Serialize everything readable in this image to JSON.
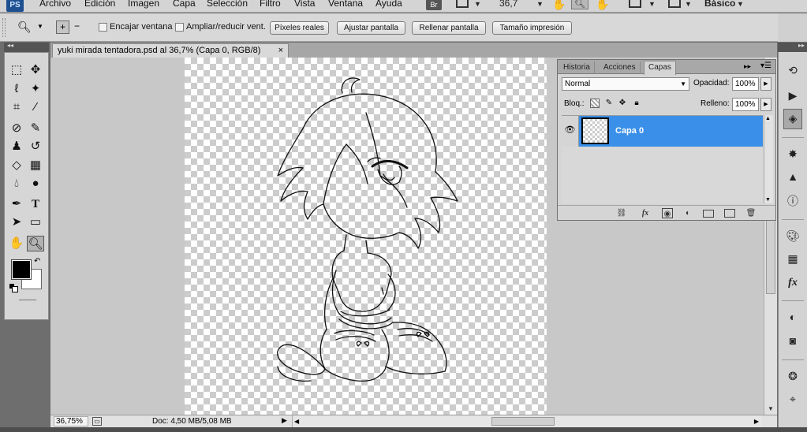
{
  "menubar": {
    "logo": "PS",
    "items": [
      "Archivo",
      "Edición",
      "Imagen",
      "Capa",
      "Selección",
      "Filtro",
      "Vista",
      "Ventana",
      "Ayuda"
    ],
    "bridge_label": "Br",
    "zoom_value": "36,7",
    "workspace": "Básico"
  },
  "options_bar": {
    "encajar_label": "Encajar ventana",
    "ampliar_label": "Ampliar/reducir vent.",
    "buttons": [
      "Píxeles reales",
      "Ajustar pantalla",
      "Rellenar pantalla",
      "Tamaño impresión"
    ]
  },
  "document": {
    "tab_title": "yuki mirada tentadora.psd al 36,7% (Capa 0, RGB/8)",
    "close_glyph": "×"
  },
  "statusbar": {
    "zoom": "36,75%",
    "doc_info": "Doc: 4,50 MB/5,08 MB"
  },
  "layers_panel": {
    "tabs": [
      "Historia",
      "Acciones",
      "Capas"
    ],
    "active_tab": "Capas",
    "blend_mode": "Normal",
    "opacity_label": "Opacidad:",
    "opacity_value": "100%",
    "lock_label": "Bloq.:",
    "fill_label": "Relleno:",
    "fill_value": "100%",
    "layers": [
      {
        "name": "Capa 0",
        "visible": true,
        "selected": true
      }
    ],
    "footer_fx": "fx"
  },
  "right_dock": {
    "styles_label": "fx"
  },
  "colors": {
    "selection_blue": "#3a8fe8",
    "foreground": "#000000",
    "background": "#ffffff",
    "workspace_bg": "#c8c8c8"
  },
  "icons": {
    "toolbar": [
      "marquee-icon",
      "move-icon",
      "lasso-icon",
      "magic-wand-icon",
      "crop-icon",
      "eyedropper-icon",
      "healing-brush-icon",
      "brush-icon",
      "clone-stamp-icon",
      "history-brush-icon",
      "eraser-icon",
      "gradient-icon",
      "blur-icon",
      "dodge-icon",
      "pen-icon",
      "type-icon",
      "path-selection-icon",
      "shape-icon",
      "hand-icon",
      "zoom-icon"
    ],
    "dock": [
      "history-icon",
      "actions-icon",
      "layers-icon",
      "navigator-icon",
      "histogram-icon",
      "info-icon",
      "color-icon",
      "swatches-icon",
      "styles-icon",
      "adjustments-icon",
      "masks-icon",
      "channels-icon",
      "paths-icon"
    ]
  }
}
